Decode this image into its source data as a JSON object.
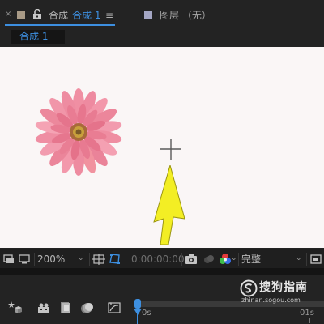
{
  "tabs": {
    "close_glyph": "×",
    "comp_label": "合成",
    "comp_name": "合成 1",
    "menu_glyph": "≡",
    "layer_label": "图层 （无）",
    "comp_swatch_color": "#a89a86",
    "layer_swatch_color": "#a4a6c4"
  },
  "breadcrumb": {
    "label": "合成 1"
  },
  "viewer": {
    "background": "#faf6f6",
    "subject": "pink-gerbera-flower",
    "annotation": "yellow-arrow"
  },
  "viewer_toolbar": {
    "zoom": "200%",
    "timecode": "0:00:00:00",
    "resolution": "完整",
    "dropdown_glyph": "⌄"
  },
  "timeline": {
    "tick_start": "0s",
    "tick_end": "01s",
    "accent": "#3d8fe0"
  },
  "watermark": {
    "text": "搜狗指南",
    "url": "zhinan.sogou.com"
  }
}
